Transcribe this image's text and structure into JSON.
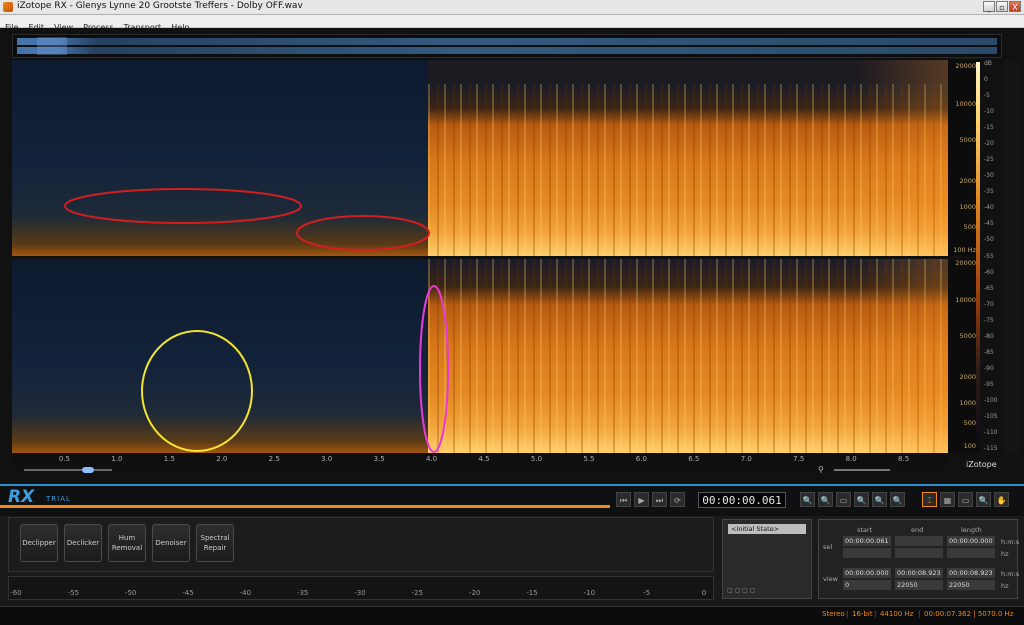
{
  "window": {
    "title": "iZotope RX - Glenys Lynne 20 Grootste Treffers - Dolby OFF.wav",
    "buttons": {
      "minimize": "_",
      "maximize": "▫",
      "close": "X"
    }
  },
  "menu": [
    "File",
    "Edit",
    "View",
    "Process",
    "Transport",
    "Help"
  ],
  "freq_scale_top": [
    "20000",
    "10000",
    "5000",
    "2000",
    "1000",
    "500",
    "100 Hz"
  ],
  "freq_scale_bottom": [
    "20000",
    "10000",
    "5000",
    "2000",
    "1000",
    "500",
    "100"
  ],
  "db_scale": [
    "dB",
    "0",
    "-5",
    "-10",
    "-15",
    "-20",
    "-25",
    "-30",
    "-35",
    "-40",
    "-45",
    "-50",
    "-55",
    "-60",
    "-65",
    "-70",
    "-75",
    "-80",
    "-85",
    "-90",
    "-95",
    "-100",
    "-105",
    "-110",
    "-115"
  ],
  "time_axis": [
    "0.5",
    "1.0",
    "1.5",
    "2.0",
    "2.5",
    "3.0",
    "3.5",
    "4.0",
    "4.5",
    "5.0",
    "5.5",
    "6.0",
    "6.5",
    "7.0",
    "7.5",
    "8.0",
    "8.5"
  ],
  "annotations": {
    "ellipse_top_left_color": "#d11f1f",
    "ellipse_top_right_color": "#d11f1f",
    "circle_yellow_color": "#f2e430",
    "ellipse_magenta_color": "#e63bd8"
  },
  "brand": {
    "logo": "RX",
    "trial": "TRIAL",
    "corner_logo": "iZotope"
  },
  "transport": {
    "buttons": [
      "⏮",
      "▶",
      "⏭",
      "⟳"
    ],
    "time": "00:00:00.061"
  },
  "tools": [
    "🔍",
    "🔍",
    "▭",
    "🔍",
    "🔍",
    "🔍",
    "⌶",
    "▦",
    "▭",
    "🔍",
    "✋"
  ],
  "modules": [
    {
      "label": "Declipper"
    },
    {
      "label": "Declicker"
    },
    {
      "label": "Hum Removal"
    },
    {
      "label": "Denoiser"
    },
    {
      "label": "Spectral Repair"
    }
  ],
  "meter_scale": [
    "-60",
    "-55",
    "-50",
    "-45",
    "-40",
    "-35",
    "-30",
    "-25",
    "-20",
    "-15",
    "-10",
    "-5",
    "0"
  ],
  "history": {
    "item": "<Initial State>"
  },
  "selection": {
    "headers": {
      "start": "start",
      "end": "end",
      "length": "length"
    },
    "sel_label": "sel",
    "view_label": "view",
    "sel_start": "00:00:00.061",
    "sel_end": "",
    "sel_length": "00:00:00.000",
    "sel_hz_start": "",
    "sel_hz_end": "",
    "sel_hz_length": "",
    "view_start": "00:00:00.000",
    "view_end": "00:00:08.923",
    "view_length": "00:00:08.923",
    "view_hz_start": "0",
    "view_hz_end": "22050",
    "view_hz_length": "22050",
    "unit_time": "h:m:s",
    "unit_hz": "hz"
  },
  "status": [
    "Stereo",
    "16-bit",
    "44100 Hz",
    "00:00:07.362 | 5070.0 Hz"
  ]
}
